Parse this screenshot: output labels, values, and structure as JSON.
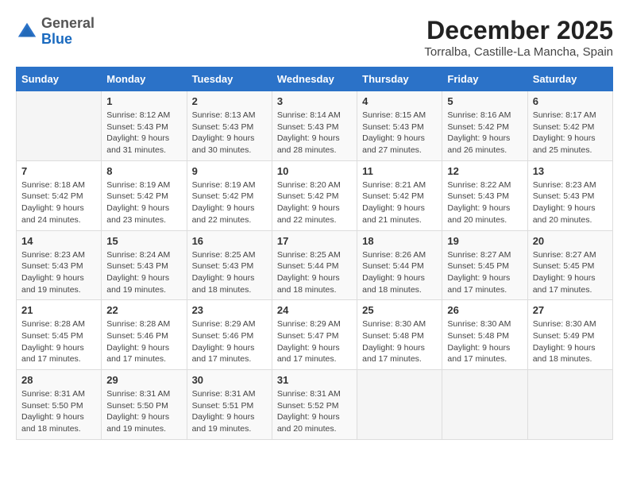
{
  "header": {
    "logo_general": "General",
    "logo_blue": "Blue",
    "main_title": "December 2025",
    "sub_title": "Torralba, Castille-La Mancha, Spain"
  },
  "calendar": {
    "days_of_week": [
      "Sunday",
      "Monday",
      "Tuesday",
      "Wednesday",
      "Thursday",
      "Friday",
      "Saturday"
    ],
    "weeks": [
      [
        {
          "day": "",
          "sunrise": "",
          "sunset": "",
          "daylight": ""
        },
        {
          "day": "1",
          "sunrise": "Sunrise: 8:12 AM",
          "sunset": "Sunset: 5:43 PM",
          "daylight": "Daylight: 9 hours and 31 minutes."
        },
        {
          "day": "2",
          "sunrise": "Sunrise: 8:13 AM",
          "sunset": "Sunset: 5:43 PM",
          "daylight": "Daylight: 9 hours and 30 minutes."
        },
        {
          "day": "3",
          "sunrise": "Sunrise: 8:14 AM",
          "sunset": "Sunset: 5:43 PM",
          "daylight": "Daylight: 9 hours and 28 minutes."
        },
        {
          "day": "4",
          "sunrise": "Sunrise: 8:15 AM",
          "sunset": "Sunset: 5:43 PM",
          "daylight": "Daylight: 9 hours and 27 minutes."
        },
        {
          "day": "5",
          "sunrise": "Sunrise: 8:16 AM",
          "sunset": "Sunset: 5:42 PM",
          "daylight": "Daylight: 9 hours and 26 minutes."
        },
        {
          "day": "6",
          "sunrise": "Sunrise: 8:17 AM",
          "sunset": "Sunset: 5:42 PM",
          "daylight": "Daylight: 9 hours and 25 minutes."
        }
      ],
      [
        {
          "day": "7",
          "sunrise": "Sunrise: 8:18 AM",
          "sunset": "Sunset: 5:42 PM",
          "daylight": "Daylight: 9 hours and 24 minutes."
        },
        {
          "day": "8",
          "sunrise": "Sunrise: 8:19 AM",
          "sunset": "Sunset: 5:42 PM",
          "daylight": "Daylight: 9 hours and 23 minutes."
        },
        {
          "day": "9",
          "sunrise": "Sunrise: 8:19 AM",
          "sunset": "Sunset: 5:42 PM",
          "daylight": "Daylight: 9 hours and 22 minutes."
        },
        {
          "day": "10",
          "sunrise": "Sunrise: 8:20 AM",
          "sunset": "Sunset: 5:42 PM",
          "daylight": "Daylight: 9 hours and 22 minutes."
        },
        {
          "day": "11",
          "sunrise": "Sunrise: 8:21 AM",
          "sunset": "Sunset: 5:42 PM",
          "daylight": "Daylight: 9 hours and 21 minutes."
        },
        {
          "day": "12",
          "sunrise": "Sunrise: 8:22 AM",
          "sunset": "Sunset: 5:43 PM",
          "daylight": "Daylight: 9 hours and 20 minutes."
        },
        {
          "day": "13",
          "sunrise": "Sunrise: 8:23 AM",
          "sunset": "Sunset: 5:43 PM",
          "daylight": "Daylight: 9 hours and 20 minutes."
        }
      ],
      [
        {
          "day": "14",
          "sunrise": "Sunrise: 8:23 AM",
          "sunset": "Sunset: 5:43 PM",
          "daylight": "Daylight: 9 hours and 19 minutes."
        },
        {
          "day": "15",
          "sunrise": "Sunrise: 8:24 AM",
          "sunset": "Sunset: 5:43 PM",
          "daylight": "Daylight: 9 hours and 19 minutes."
        },
        {
          "day": "16",
          "sunrise": "Sunrise: 8:25 AM",
          "sunset": "Sunset: 5:43 PM",
          "daylight": "Daylight: 9 hours and 18 minutes."
        },
        {
          "day": "17",
          "sunrise": "Sunrise: 8:25 AM",
          "sunset": "Sunset: 5:44 PM",
          "daylight": "Daylight: 9 hours and 18 minutes."
        },
        {
          "day": "18",
          "sunrise": "Sunrise: 8:26 AM",
          "sunset": "Sunset: 5:44 PM",
          "daylight": "Daylight: 9 hours and 18 minutes."
        },
        {
          "day": "19",
          "sunrise": "Sunrise: 8:27 AM",
          "sunset": "Sunset: 5:45 PM",
          "daylight": "Daylight: 9 hours and 17 minutes."
        },
        {
          "day": "20",
          "sunrise": "Sunrise: 8:27 AM",
          "sunset": "Sunset: 5:45 PM",
          "daylight": "Daylight: 9 hours and 17 minutes."
        }
      ],
      [
        {
          "day": "21",
          "sunrise": "Sunrise: 8:28 AM",
          "sunset": "Sunset: 5:45 PM",
          "daylight": "Daylight: 9 hours and 17 minutes."
        },
        {
          "day": "22",
          "sunrise": "Sunrise: 8:28 AM",
          "sunset": "Sunset: 5:46 PM",
          "daylight": "Daylight: 9 hours and 17 minutes."
        },
        {
          "day": "23",
          "sunrise": "Sunrise: 8:29 AM",
          "sunset": "Sunset: 5:46 PM",
          "daylight": "Daylight: 9 hours and 17 minutes."
        },
        {
          "day": "24",
          "sunrise": "Sunrise: 8:29 AM",
          "sunset": "Sunset: 5:47 PM",
          "daylight": "Daylight: 9 hours and 17 minutes."
        },
        {
          "day": "25",
          "sunrise": "Sunrise: 8:30 AM",
          "sunset": "Sunset: 5:48 PM",
          "daylight": "Daylight: 9 hours and 17 minutes."
        },
        {
          "day": "26",
          "sunrise": "Sunrise: 8:30 AM",
          "sunset": "Sunset: 5:48 PM",
          "daylight": "Daylight: 9 hours and 17 minutes."
        },
        {
          "day": "27",
          "sunrise": "Sunrise: 8:30 AM",
          "sunset": "Sunset: 5:49 PM",
          "daylight": "Daylight: 9 hours and 18 minutes."
        }
      ],
      [
        {
          "day": "28",
          "sunrise": "Sunrise: 8:31 AM",
          "sunset": "Sunset: 5:50 PM",
          "daylight": "Daylight: 9 hours and 18 minutes."
        },
        {
          "day": "29",
          "sunrise": "Sunrise: 8:31 AM",
          "sunset": "Sunset: 5:50 PM",
          "daylight": "Daylight: 9 hours and 19 minutes."
        },
        {
          "day": "30",
          "sunrise": "Sunrise: 8:31 AM",
          "sunset": "Sunset: 5:51 PM",
          "daylight": "Daylight: 9 hours and 19 minutes."
        },
        {
          "day": "31",
          "sunrise": "Sunrise: 8:31 AM",
          "sunset": "Sunset: 5:52 PM",
          "daylight": "Daylight: 9 hours and 20 minutes."
        },
        {
          "day": "",
          "sunrise": "",
          "sunset": "",
          "daylight": ""
        },
        {
          "day": "",
          "sunrise": "",
          "sunset": "",
          "daylight": ""
        },
        {
          "day": "",
          "sunrise": "",
          "sunset": "",
          "daylight": ""
        }
      ]
    ]
  }
}
